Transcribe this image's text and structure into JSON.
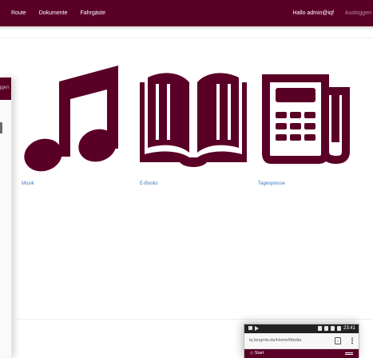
{
  "navbar": {
    "links": [
      "Route",
      "Dokumente",
      "Fahrgäste"
    ],
    "user": "Hallo admin@iqf",
    "logout": "Ausloggen",
    "background": "#5a0027"
  },
  "left_overlay": {
    "partial_text": "ggen"
  },
  "media": {
    "items": [
      {
        "label": "Musik",
        "icon": "music-note-icon"
      },
      {
        "label": "E-Books",
        "icon": "open-book-icon"
      },
      {
        "label": "Tagespresse",
        "icon": "newspaper-icon"
      }
    ],
    "icon_color": "#5a0027",
    "link_color": "#3a79b6"
  },
  "phone": {
    "time": "23:41",
    "url": "iq.longmis.de/Home/Media",
    "tab_count": "1",
    "app_title": "◇ Start"
  }
}
